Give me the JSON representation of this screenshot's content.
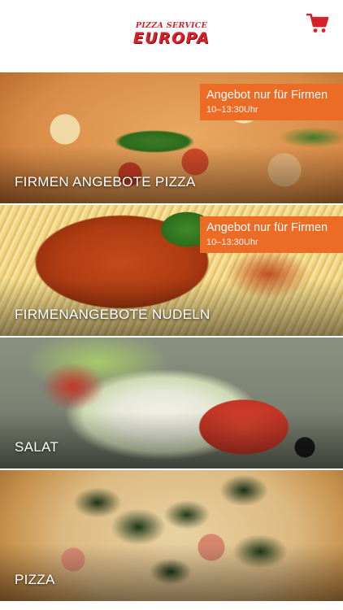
{
  "header": {
    "logo": {
      "top_text": "PIZZA SERVICE",
      "main_text": "EUROPA"
    },
    "cart_icon": "shopping-cart-icon"
  },
  "tiles": [
    {
      "title": "FIRMEN ANGEBOTE PIZZA",
      "offer": {
        "title": "Angebot nur für Firmen",
        "time": "10–13:30Uhr"
      }
    },
    {
      "title": "FIRMENANGEBOTE NUDELN",
      "offer": {
        "title": "Angebot nur für Firmen",
        "time": "10–13:30Uhr"
      }
    },
    {
      "title": "SALAT"
    },
    {
      "title": "PIZZA"
    }
  ],
  "colors": {
    "brand_red": "#d8202a",
    "offer_orange": "#ec6b25"
  }
}
